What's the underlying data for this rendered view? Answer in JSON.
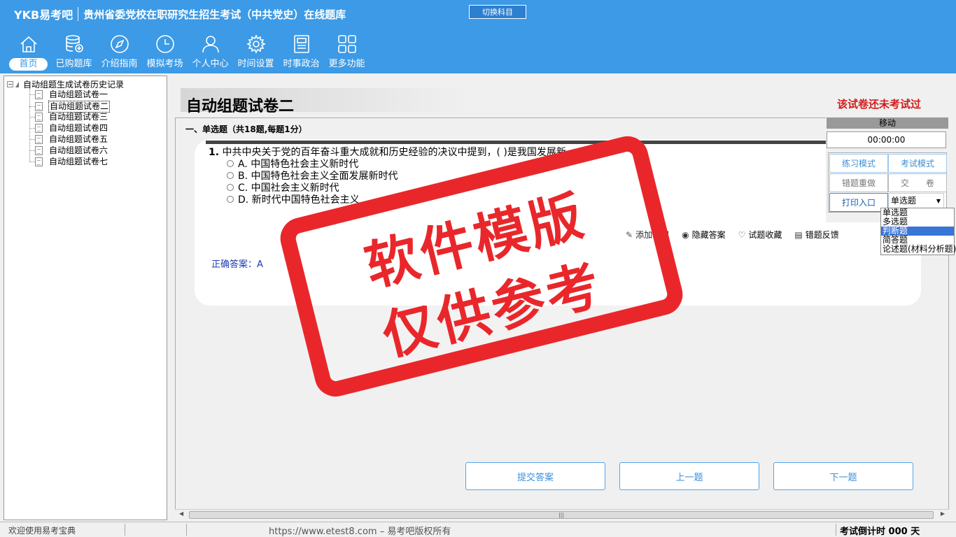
{
  "header": {
    "brand": "YKB易考吧",
    "title": "贵州省委党校在职研究生招生考试（中共党史）在线题库",
    "switch_label": "切换科目"
  },
  "nav": [
    {
      "label": "首页",
      "icon": "home-icon"
    },
    {
      "label": "已购题库",
      "icon": "database-icon"
    },
    {
      "label": "介绍指南",
      "icon": "compass-icon"
    },
    {
      "label": "模拟考场",
      "icon": "clock-icon"
    },
    {
      "label": "个人中心",
      "icon": "user-icon"
    },
    {
      "label": "时间设置",
      "icon": "gear-icon"
    },
    {
      "label": "时事政治",
      "icon": "news-icon"
    },
    {
      "label": "更多功能",
      "icon": "grid-icon"
    }
  ],
  "tree": {
    "root": "自动组题生成试卷历史记录",
    "items": [
      "自动组题试卷一",
      "自动组题试卷二",
      "自动组题试卷三",
      "自动组题试卷四",
      "自动组题试卷五",
      "自动组题试卷六",
      "自动组题试卷七"
    ],
    "selected_index": 1
  },
  "paper": {
    "title": "自动组题试卷二",
    "status": "该试卷还未考试过",
    "section": "一、单选题（共18题,每题1分）"
  },
  "question": {
    "number": "1.",
    "text": "中共中央关于党的百年奋斗重大成就和历史经验的决议中提到，(  )是我国发展新",
    "options": [
      "A. 中国特色社会主义新时代",
      "B. 中国特色社会主义全面发展新时代",
      "C. 中国社会主义新时代",
      "D. 新时代中国特色社会主义"
    ],
    "actions": [
      {
        "label": "添加笔记",
        "icon": "pencil-icon"
      },
      {
        "label": "隐藏答案",
        "icon": "eye-icon"
      },
      {
        "label": "试题收藏",
        "icon": "heart-icon"
      },
      {
        "label": "错题反馈",
        "icon": "feedback-icon"
      }
    ],
    "answer": "正确答案：A"
  },
  "buttons": {
    "submit": "提交答案",
    "prev": "上一题",
    "next": "下一题"
  },
  "control": {
    "move": "移动",
    "timer": "00:00:00",
    "practice": "练习模式",
    "exam": "考试模式",
    "redo": "错题重做",
    "hand_in": "交　　卷",
    "print": "打印入口",
    "select_value": "单选题",
    "options": [
      "单选题",
      "多选题",
      "判断题",
      "简答题",
      "论述题(材料分析题)"
    ],
    "highlight_index": 2
  },
  "stamp": {
    "line1": "软件模版",
    "line2": "仅供参考"
  },
  "status": {
    "welcome": "欢迎使用易考宝典",
    "url": "https://www.etest8.com – 易考吧版权所有",
    "countdown": "考试倒计时 000 天"
  },
  "colors": {
    "header_bg": "#3c9ae6",
    "accent": "#3c8fd9",
    "warning": "#d01b1b",
    "stamp": "#e9272b",
    "answer": "#1a3bb5"
  }
}
